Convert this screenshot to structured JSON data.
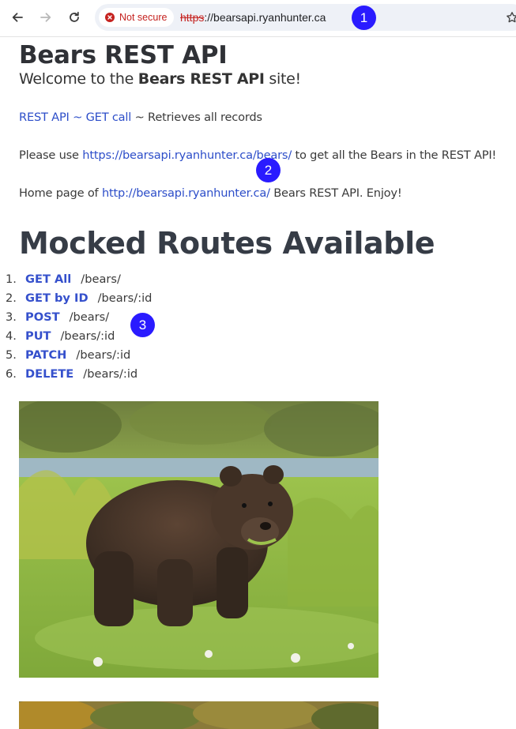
{
  "browser": {
    "security_label": "Not secure",
    "url_scheme": "https",
    "url_rest": "://bearsapi.ryanhunter.ca",
    "icons": [
      "back-arrow-icon",
      "forward-arrow-icon",
      "reload-icon",
      "warning-icon",
      "bookmark-star-icon"
    ]
  },
  "markers": [
    "1",
    "2",
    "3"
  ],
  "page": {
    "title": "Bears REST API",
    "welcome_prefix": "Welcome to the ",
    "welcome_bold": "Bears REST API",
    "welcome_suffix": " site!",
    "rest_link": "REST API",
    "tilde1": " ~ ",
    "get_call_link": "GET call",
    "tilde2": " ~ Retrieves all records",
    "please_prefix": "Please use ",
    "bears_link": "https://bearsapi.ryanhunter.ca/bears/",
    "please_suffix": " to get all the Bears in the REST API!",
    "home_prefix": "Home page of ",
    "home_link": "http://bearsapi.ryanhunter.ca/",
    "home_suffix": " Bears REST API. Enjoy!",
    "routes_title": "Mocked Routes Available",
    "routes": [
      {
        "num": "1.",
        "method": "GET All",
        "path": "/bears/"
      },
      {
        "num": "2.",
        "method": "GET by ID",
        "path": "/bears/:id"
      },
      {
        "num": "3.",
        "method": "POST",
        "path": "/bears/"
      },
      {
        "num": "4.",
        "method": "PUT",
        "path": "/bears/:id"
      },
      {
        "num": "5.",
        "method": "PATCH",
        "path": "/bears/:id"
      },
      {
        "num": "6.",
        "method": "DELETE",
        "path": "/bears/:id"
      }
    ]
  },
  "colors": {
    "link": "#2d4ec9",
    "method": "#3550cc",
    "warning": "#c5221f",
    "marker": "#2a1bff"
  }
}
